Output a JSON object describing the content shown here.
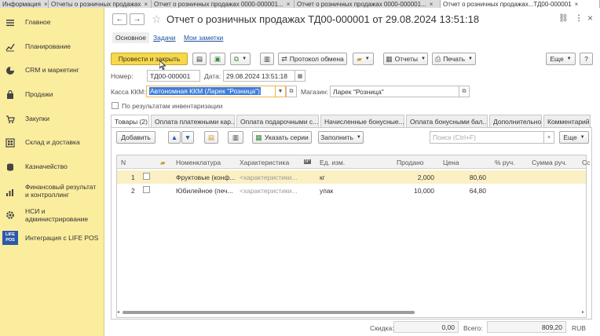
{
  "tabs": [
    {
      "label": "Информация"
    },
    {
      "label": "Отчеты о розничных продажах"
    },
    {
      "label": "Отчет о розничных продажах 0000-000001..."
    },
    {
      "label": "Отчет о розничных продажах 0000-000001..."
    },
    {
      "label": "Отчет о розничных продажах...ТД00-000001"
    }
  ],
  "sidebar": {
    "items": [
      {
        "label": "Главное",
        "icon": "menu-icon"
      },
      {
        "label": "Планирование",
        "icon": "chart-icon"
      },
      {
        "label": "CRM и маркетинг",
        "icon": "pie-icon"
      },
      {
        "label": "Продажи",
        "icon": "bag-icon"
      },
      {
        "label": "Закупки",
        "icon": "cart-icon"
      },
      {
        "label": "Склад и доставка",
        "icon": "warehouse-icon"
      },
      {
        "label": "Казначейство",
        "icon": "coins-icon"
      },
      {
        "label": "Финансовый результат и контроллинг",
        "icon": "bar-chart-icon"
      },
      {
        "label": "НСИ и администрирование",
        "icon": "gear-icon"
      },
      {
        "label": "Интеграция с LIFE POS",
        "icon": "life-pos-logo"
      }
    ],
    "logo_text": "LIFE POS"
  },
  "header": {
    "title": "Отчет о розничных продажах ТД00-000001 от 29.08.2024 13:51:18",
    "back": "←",
    "forward": "→",
    "star": "☆",
    "link_icon": "🔗",
    "more_icon": "⋮",
    "close_icon": "×"
  },
  "subnav": {
    "main": "Основное",
    "tasks": "Задачи",
    "notes": "Мои заметки"
  },
  "toolbar": {
    "post_close": "Провести и закрыть",
    "exchange_protocol": "Протокол обмена",
    "reports": "Отчеты",
    "print": "Печать",
    "more": "Еще",
    "help": "?"
  },
  "form": {
    "number_label": "Номер:",
    "number_value": "ТД00-000001",
    "date_label": "Дата:",
    "date_value": "29.08.2024 13:51:18",
    "kkm_label": "Касса ККМ:",
    "kkm_value": "Автономная ККМ (Ларек \"Розница\")",
    "shop_label": "Магазин:",
    "shop_value": "Ларек \"Розница\"",
    "inventory_label": "По результатам инвентаризации"
  },
  "doc_tabs": [
    "Товары (2)",
    "Оплата платежными кар...",
    "Оплата подарочными с...",
    "Начисленные бонусные...",
    "Оплата бонусными бал...",
    "Дополнительно",
    "Комментарий"
  ],
  "table_toolbar": {
    "add": "Добавить",
    "series": "Указать серии",
    "fill": "Заполнить",
    "search_placeholder": "Поиск (Ctrl+F)",
    "more": "Еще",
    "clear": "×"
  },
  "table": {
    "headers": [
      "N",
      "Номенклатура",
      "Характеристика",
      "Ед. изм.",
      "Продано",
      "Цена",
      "% руч.",
      "Сумма руч.",
      "Сс"
    ],
    "rows": [
      {
        "n": "1",
        "item": "Фруктовые (конф...",
        "char": "<характеристики...",
        "unit": "кг",
        "sold": "2,000",
        "price": "80,60"
      },
      {
        "n": "2",
        "item": "Юбилейное (печ...",
        "char": "<характеристики...",
        "unit": "упак",
        "sold": "10,000",
        "price": "64,80"
      }
    ]
  },
  "footer": {
    "discount_label": "Скидка:",
    "discount_value": "0,00",
    "total_label": "Всего:",
    "total_value": "809,20",
    "currency": "RUB"
  }
}
